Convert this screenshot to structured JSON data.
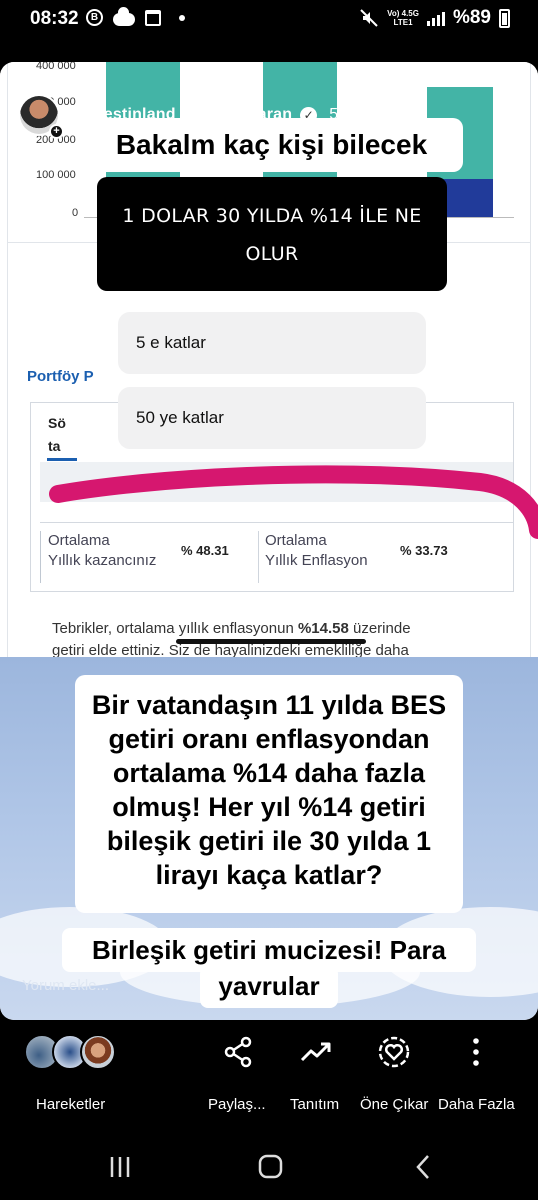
{
  "status_bar": {
    "time": "08:32",
    "network": "Vo) 4.5G",
    "network_sub": "LTE1",
    "battery": "%89"
  },
  "story": {
    "username": "investinland_mert_basaran",
    "age": "5d",
    "title_sticker": "Bakalm kaç kişi bilecek",
    "question": [
      "1 DOLAR  30 YILDA %14 İLE NE",
      "OLUR"
    ],
    "options": [
      "5 e katlar",
      "50 ye katlar"
    ],
    "body_lines": [
      "Bir vatandaşın 11 yılda BES",
      "getiri oranı enflasyondan",
      "ortalama %14 daha fazla",
      "olmuş! Her yıl %14 getiri",
      "bileşik getiri ile 30 yılda 1",
      "lirayı kaça katlar?"
    ],
    "footer_lines": [
      "Birleşik getiri mucizesi! Para",
      "yavrular"
    ],
    "comment_placeholder": "Yorum ekle..."
  },
  "screenshot": {
    "y_ticks": [
      "400 000",
      "300 000",
      "200 000",
      "100 000",
      "0"
    ],
    "portfolio_label": "Portföy P",
    "tab_fragment_1": "Sö",
    "tab_fragment_2": "ta",
    "stat1_label": [
      "Ortalama",
      "Yıllık kazancınız"
    ],
    "stat1_value": "% 48.31",
    "stat2_label": [
      "Ortalama",
      "Yıllık Enflasyon"
    ],
    "stat2_value": "% 33.73",
    "congrats_line1_pre": "Tebrikler, ortalama yıllık enflasyonun ",
    "congrats_line1_bold": "%14.58",
    "congrats_line1_post": " üzerinde",
    "congrats_line2": "getiri elde ettiniz. Siz de hayalinizdeki emekliliğe daha"
  },
  "actions": {
    "hareketler": "Hareketler",
    "paylas": "Paylaş...",
    "tanitim": "Tanıtım",
    "one_cikar": "Öne Çıkar",
    "daha_fazla": "Daha Fazla"
  },
  "colors": {
    "teal": "#43b4a6",
    "navy": "#213b9a",
    "pink_highlight": "#d6176f",
    "link_blue": "#1b5fb0"
  },
  "icons": [
    "bixby-icon",
    "cloud-icon",
    "calendar-icon",
    "mute-icon",
    "signal-icon",
    "battery-icon",
    "share-icon",
    "trending-icon",
    "highlight-heart-icon",
    "more-vertical-icon",
    "recent-apps-icon",
    "home-icon",
    "back-icon"
  ]
}
